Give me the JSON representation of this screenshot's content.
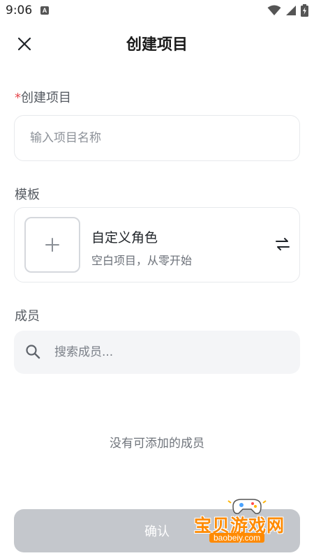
{
  "status_bar": {
    "time": "9:06",
    "notification_icon": "a-notification-icon",
    "icons": [
      "wifi-icon",
      "cellular-signal-icon",
      "battery-icon"
    ]
  },
  "header": {
    "title": "创建项目",
    "close_icon": "close-icon"
  },
  "form": {
    "name_section": {
      "required_marker": "*",
      "label": "创建项目",
      "placeholder": "输入项目名称",
      "value": ""
    },
    "template_section": {
      "label": "模板",
      "card": {
        "thumb_icon": "plus-icon",
        "name": "自定义角色",
        "description": "空白项目，从零开始",
        "action_icon": "swap-icon"
      }
    },
    "members_section": {
      "label": "成员",
      "search_placeholder": "搜索成员...",
      "search_value": "",
      "empty_message": "没有可添加的成员"
    }
  },
  "footer": {
    "confirm_label": "确认",
    "confirm_state": "disabled"
  },
  "watermark": {
    "title": "宝贝游戏网",
    "url": "baobeiy.com"
  },
  "colors": {
    "required": "#e5484d",
    "disabled_button": "#c4c7cc",
    "input_border": "#e7e9ec",
    "search_bg": "#f4f5f7",
    "watermark": "#ff8a00"
  }
}
